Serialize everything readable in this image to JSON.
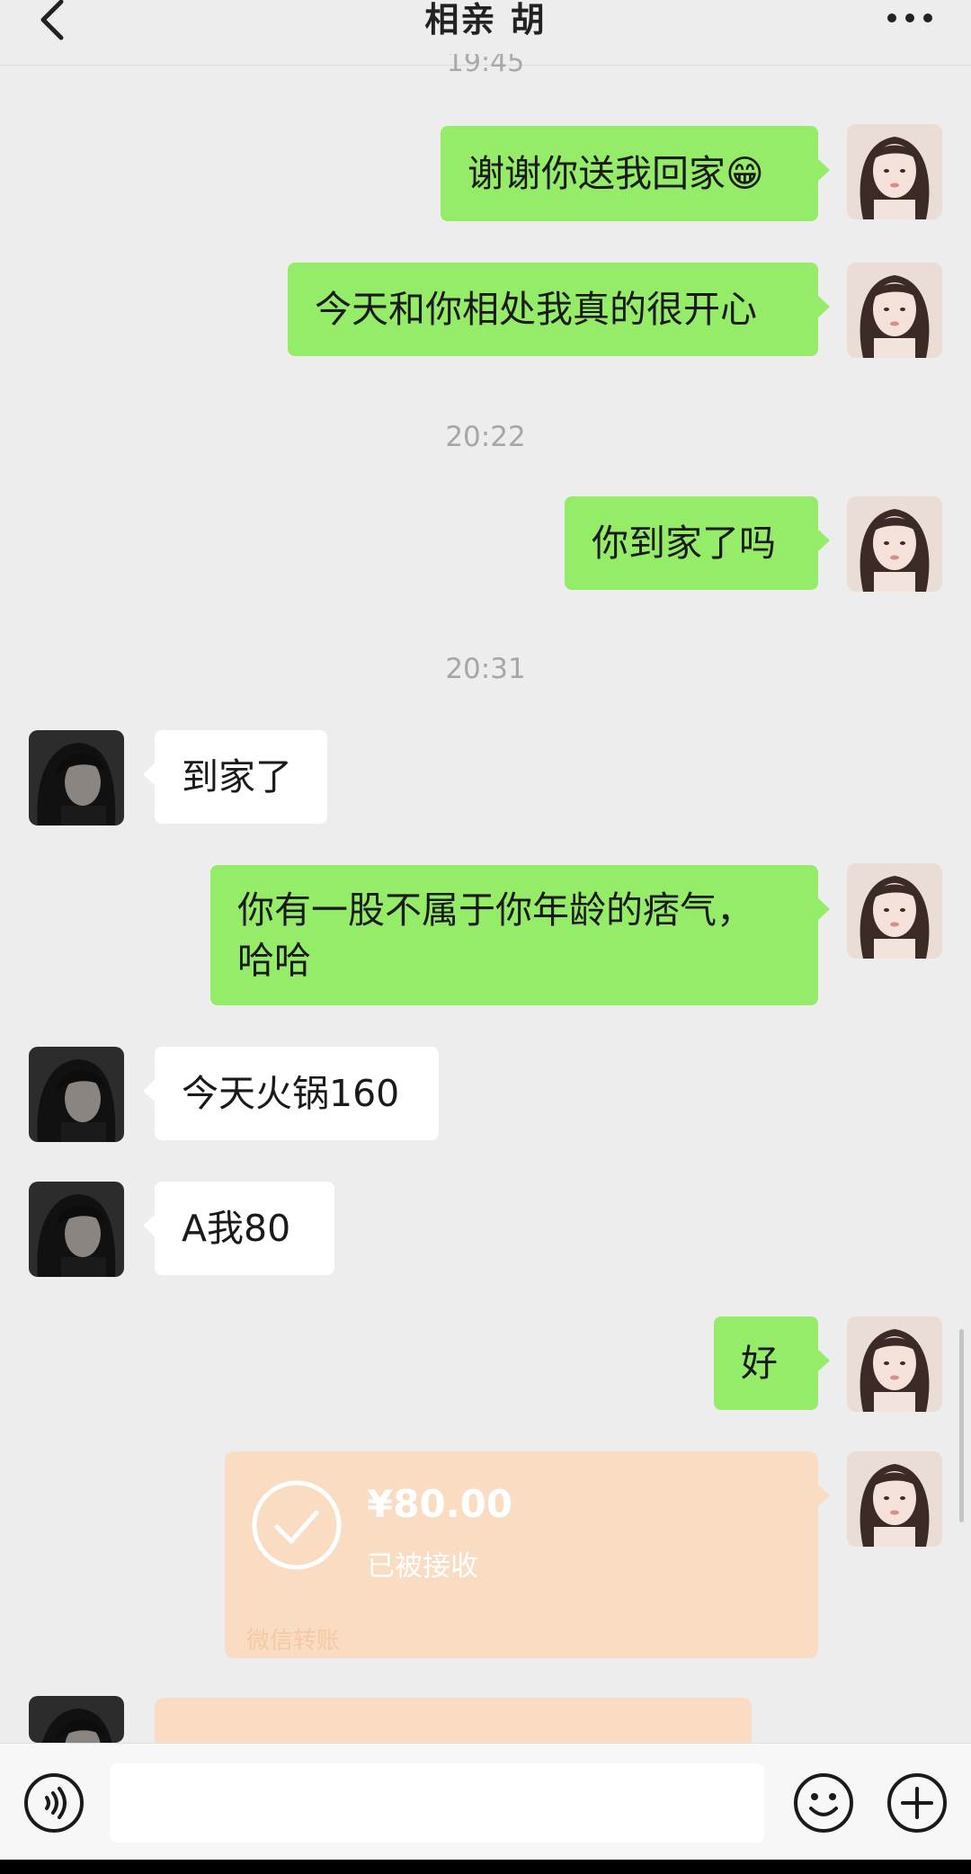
{
  "header": {
    "title": "相亲 胡",
    "partial_timestamp": "19:45"
  },
  "messages": [
    {
      "id": "m1",
      "sender": "me",
      "text": "谢谢你送我回家😁"
    },
    {
      "id": "m2",
      "sender": "me",
      "text": "今天和你相处我真的很开心"
    },
    {
      "id": "t1",
      "type": "timestamp",
      "text": "20:22"
    },
    {
      "id": "m3",
      "sender": "me",
      "text": "你到家了吗"
    },
    {
      "id": "t2",
      "type": "timestamp",
      "text": "20:31"
    },
    {
      "id": "m4",
      "sender": "him",
      "text": "到家了"
    },
    {
      "id": "m5",
      "sender": "me",
      "line1": "你有一股不属于你年龄的痞气，",
      "line2": "哈哈"
    },
    {
      "id": "m6",
      "sender": "him",
      "text": "今天火锅160"
    },
    {
      "id": "m7",
      "sender": "him",
      "text": "A我80"
    },
    {
      "id": "m8",
      "sender": "me",
      "text": "好"
    }
  ],
  "transfer": {
    "amount": "¥80.00",
    "status": "已被接收",
    "footer": "微信转账"
  },
  "colors": {
    "my_bubble": "#95ec69",
    "his_bubble": "#ffffff",
    "transfer_card": "#f9dcc2",
    "background": "#ededed"
  },
  "icons": {
    "back": "chevron-left-icon",
    "more": "more-dots-icon",
    "voice": "voice-icon",
    "emoji": "emoji-icon",
    "add": "plus-icon",
    "transfer_check": "check-circle-icon"
  }
}
